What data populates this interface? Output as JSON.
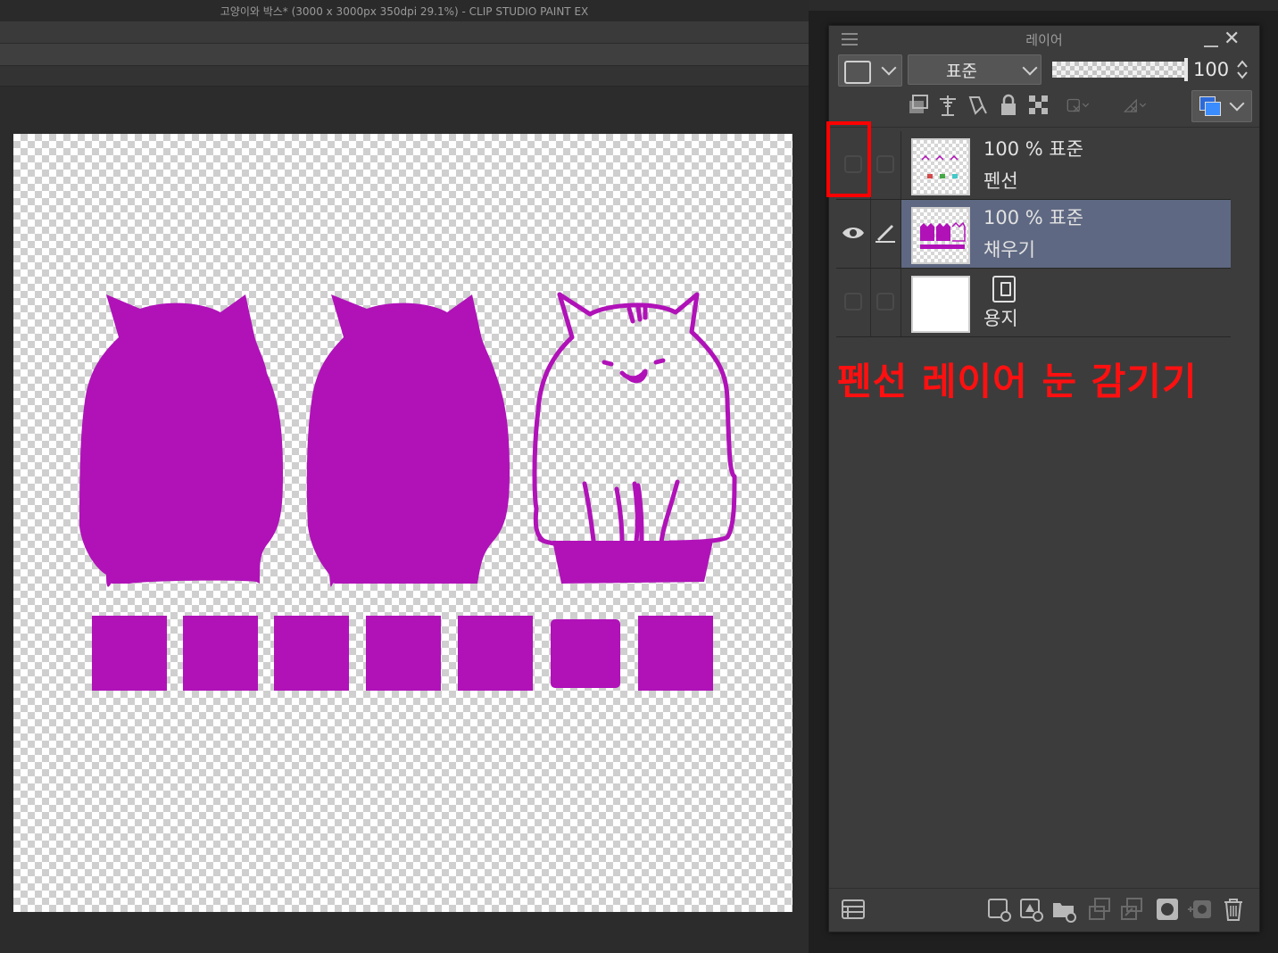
{
  "window": {
    "title": "고양이와 박스* (3000 x 3000px 350dpi 29.1%)  - CLIP STUDIO PAINT EX"
  },
  "layer_panel": {
    "title": "레이어",
    "blend_mode": "표준",
    "opacity": "100",
    "layers": [
      {
        "line1": "100 % 표준",
        "name": "펜선",
        "visible": false,
        "selected": false
      },
      {
        "line1": "100 % 표준",
        "name": "채우기",
        "visible": true,
        "selected": true
      },
      {
        "line1": "",
        "name": "용지",
        "visible": false,
        "selected": false
      }
    ]
  },
  "annotation": {
    "text": "펜선 레이어 눈 감기기",
    "color": "#ff1010"
  },
  "colors": {
    "fill_purple": "#b012b8",
    "selected_row": "#5e6882",
    "panel_bg": "#3c3c3c"
  }
}
